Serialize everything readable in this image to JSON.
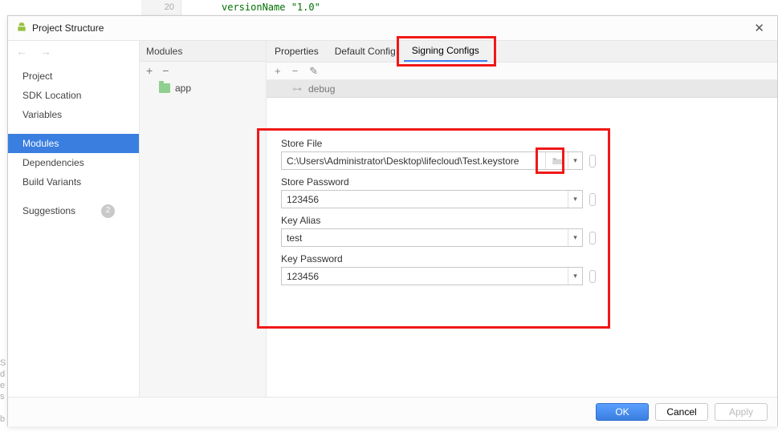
{
  "background": {
    "gutter_line": "20",
    "code_fragment": "versionName \"1.0\""
  },
  "titlebar": {
    "title": "Project Structure",
    "close_glyph": "✕"
  },
  "sidebar": {
    "items": [
      {
        "label": "Project"
      },
      {
        "label": "SDK Location"
      },
      {
        "label": "Variables"
      },
      {
        "label": "Modules"
      },
      {
        "label": "Dependencies"
      },
      {
        "label": "Build Variants"
      }
    ],
    "suggestions_label": "Suggestions",
    "suggestions_badge": "2"
  },
  "modules_col": {
    "header": "Modules",
    "items": [
      {
        "label": "app"
      }
    ]
  },
  "tabs": [
    {
      "label": "Properties"
    },
    {
      "label": "Default Config"
    },
    {
      "label": "Signing Configs"
    }
  ],
  "sub_toolbar": {
    "add": "+",
    "remove": "−",
    "edit": "pencil"
  },
  "config_row": {
    "name": "debug",
    "key_glyph": "⊶"
  },
  "fields": {
    "store_file": {
      "label": "Store File",
      "value": "C:\\Users\\Administrator\\Desktop\\lifecloud\\Test.keystore"
    },
    "store_password": {
      "label": "Store Password",
      "value": "123456"
    },
    "key_alias": {
      "label": "Key Alias",
      "value": "test"
    },
    "key_password": {
      "label": "Key Password",
      "value": "123456"
    }
  },
  "footer": {
    "ok": "OK",
    "cancel": "Cancel",
    "apply": "Apply"
  }
}
